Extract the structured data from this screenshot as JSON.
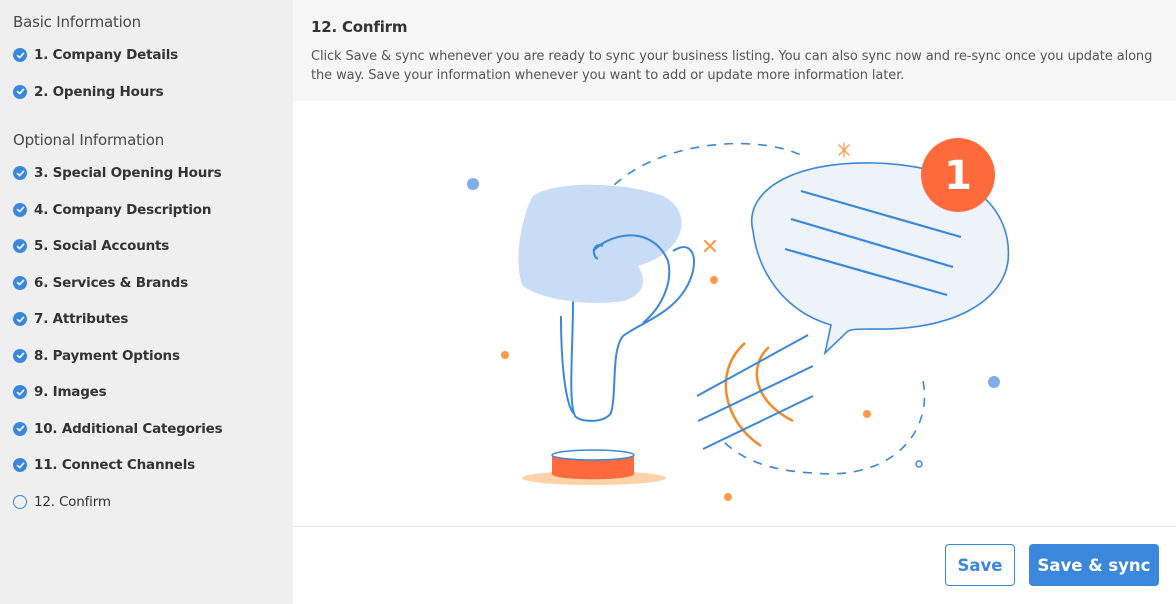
{
  "sidebar": {
    "basic_title": "Basic Information",
    "optional_title": "Optional Information",
    "basic_items": [
      {
        "label": "1. Company Details",
        "status": "complete"
      },
      {
        "label": "2. Opening Hours",
        "status": "complete"
      }
    ],
    "optional_items": [
      {
        "label": "3. Special Opening Hours",
        "status": "complete"
      },
      {
        "label": "4. Company Description",
        "status": "complete"
      },
      {
        "label": "5. Social Accounts",
        "status": "complete"
      },
      {
        "label": "6. Services & Brands",
        "status": "complete"
      },
      {
        "label": "7. Attributes",
        "status": "complete"
      },
      {
        "label": "8. Payment Options",
        "status": "complete"
      },
      {
        "label": "9. Images",
        "status": "complete"
      },
      {
        "label": "10. Additional Categories",
        "status": "complete"
      },
      {
        "label": "11. Connect Channels",
        "status": "complete"
      },
      {
        "label": "12. Confirm",
        "status": "current"
      }
    ]
  },
  "main": {
    "title": "12. Confirm",
    "description": "Click Save & sync whenever you are ready to sync your business listing. You can also sync now and re-sync once you update along the way. Save your information whenever you want to add or update more information later.",
    "illustration_badge": "1"
  },
  "footer": {
    "save_label": "Save",
    "save_sync_label": "Save & sync"
  },
  "colors": {
    "accent": "#3a87db",
    "orange": "#ff6a3d",
    "light_blue": "#c9dcf5"
  }
}
